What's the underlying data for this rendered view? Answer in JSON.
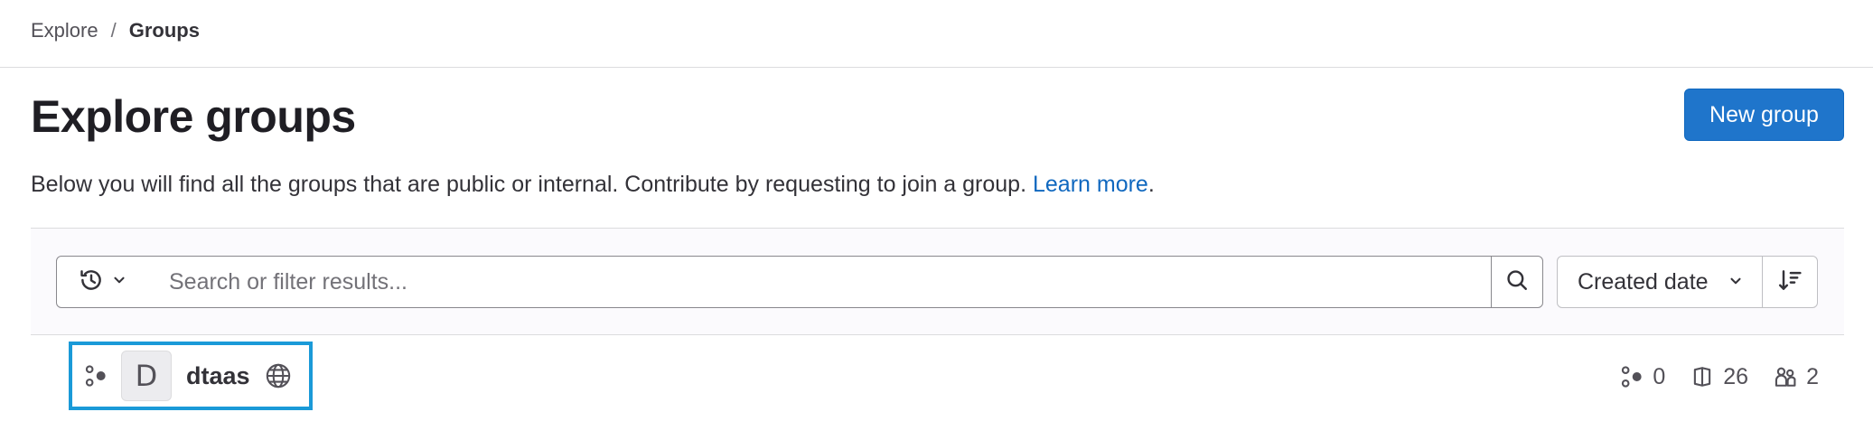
{
  "breadcrumb": {
    "items": [
      "Explore",
      "Groups"
    ],
    "separator": "/"
  },
  "header": {
    "title": "Explore groups",
    "new_group_label": "New group"
  },
  "description": {
    "text": "Below you will find all the groups that are public or internal. Contribute by requesting to join a group. ",
    "link_text": "Learn more",
    "trailing": "."
  },
  "filter": {
    "history_icon": "history-icon",
    "search_placeholder": "Search or filter results...",
    "search_icon": "search-icon",
    "sort_label": "Created date",
    "sort_direction_icon": "sort-lowest-icon"
  },
  "groups": [
    {
      "avatar_letter": "D",
      "name": "dtaas",
      "visibility_icon": "earth-icon",
      "subgroups": "0",
      "projects": "26",
      "members": "2"
    }
  ],
  "colors": {
    "primary": "#1f75cb",
    "link": "#1068bf",
    "highlight": "#1a9ad8",
    "text": "#1f1e24"
  }
}
